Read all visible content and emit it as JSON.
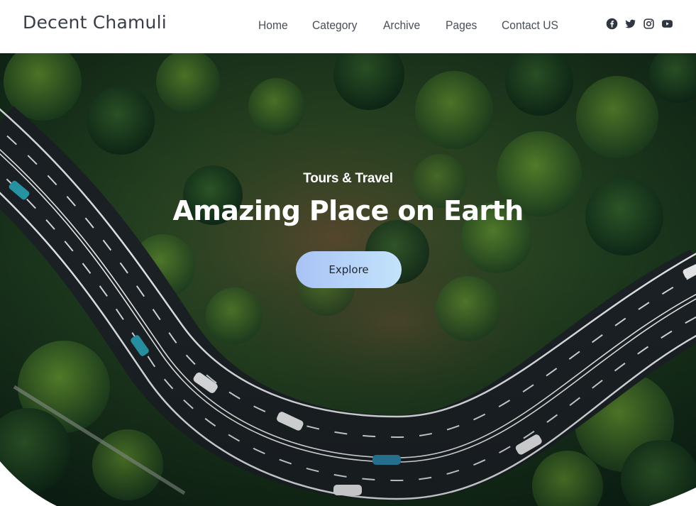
{
  "brand": {
    "name": "Decent Chamuli"
  },
  "nav": {
    "items": [
      {
        "label": "Home"
      },
      {
        "label": "Category"
      },
      {
        "label": "Archive"
      },
      {
        "label": "Pages"
      },
      {
        "label": "Contact US"
      }
    ]
  },
  "social": {
    "icons": [
      "facebook-icon",
      "twitter-icon",
      "instagram-icon",
      "youtube-icon"
    ],
    "color": "#2f3640"
  },
  "hero": {
    "subtitle": "Tours & Travel",
    "title": "Amazing Place on Earth",
    "button_label": "Explore",
    "background": "aerial view of a winding road through a forest",
    "colors": {
      "button_start": "#a9c3f5",
      "button_end": "#c3e3fb",
      "text": "#ffffff"
    }
  }
}
